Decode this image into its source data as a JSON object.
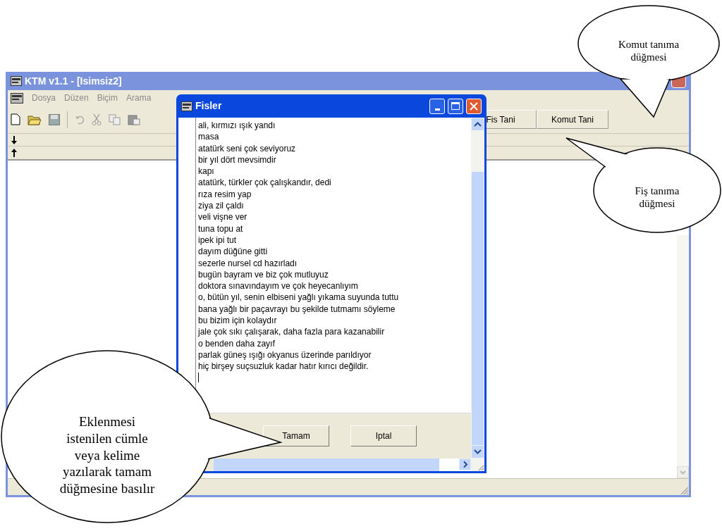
{
  "main_window": {
    "title": "KTM v1.1 - [Isimsiz2]",
    "menu": [
      "Dosya",
      "Düzen",
      "Biçim",
      "Arama"
    ],
    "toolbar_buttons": [
      "Fis Tani",
      "Komut Tani"
    ]
  },
  "dialog": {
    "title": "Fisler",
    "lines": [
      "ali, kırmızı ışık yandı",
      "masa",
      "atatürk seni çok seviyoruz",
      "bir yıl dört mevsimdir",
      "kapı",
      "atatürk, türkler çok çalışkandır, dedi",
      "rıza resim yap",
      "ziya zil çaldı",
      "veli vişne ver",
      "tuna topu at",
      "ipek ipi tut",
      "dayım düğüne gitti",
      "sezerle nursel cd hazırladı",
      "bugün bayram ve biz çok mutluyuz",
      "doktora sınavındayım ve çok heyecanlıyım",
      "o, bütün yıl, senin elbiseni yağlı yıkama suyunda tuttu",
      "bana yağlı bir paçavrayı bu şekilde tutmamı söyleme",
      "bu bizim için kolaydır",
      "jale çok sıkı çalışarak, daha fazla para kazanabilir",
      "o benden daha zayıf",
      "parlak güneş ışığı okyanus üzerinde parıldıyor",
      "hiç birşey suçsuzluk kadar hatır kırıcı değildir."
    ],
    "buttons": [
      "Tamam",
      "Iptal"
    ]
  },
  "callouts": [
    {
      "text": "Komut tanıma\ndüğmesi"
    },
    {
      "text": "Fiş tanıma\ndüğmesi"
    },
    {
      "text": "Eklenmesi\nistenilen cümle\nveya kelime\nyazılarak tamam\ndüğmesine basılır"
    }
  ]
}
